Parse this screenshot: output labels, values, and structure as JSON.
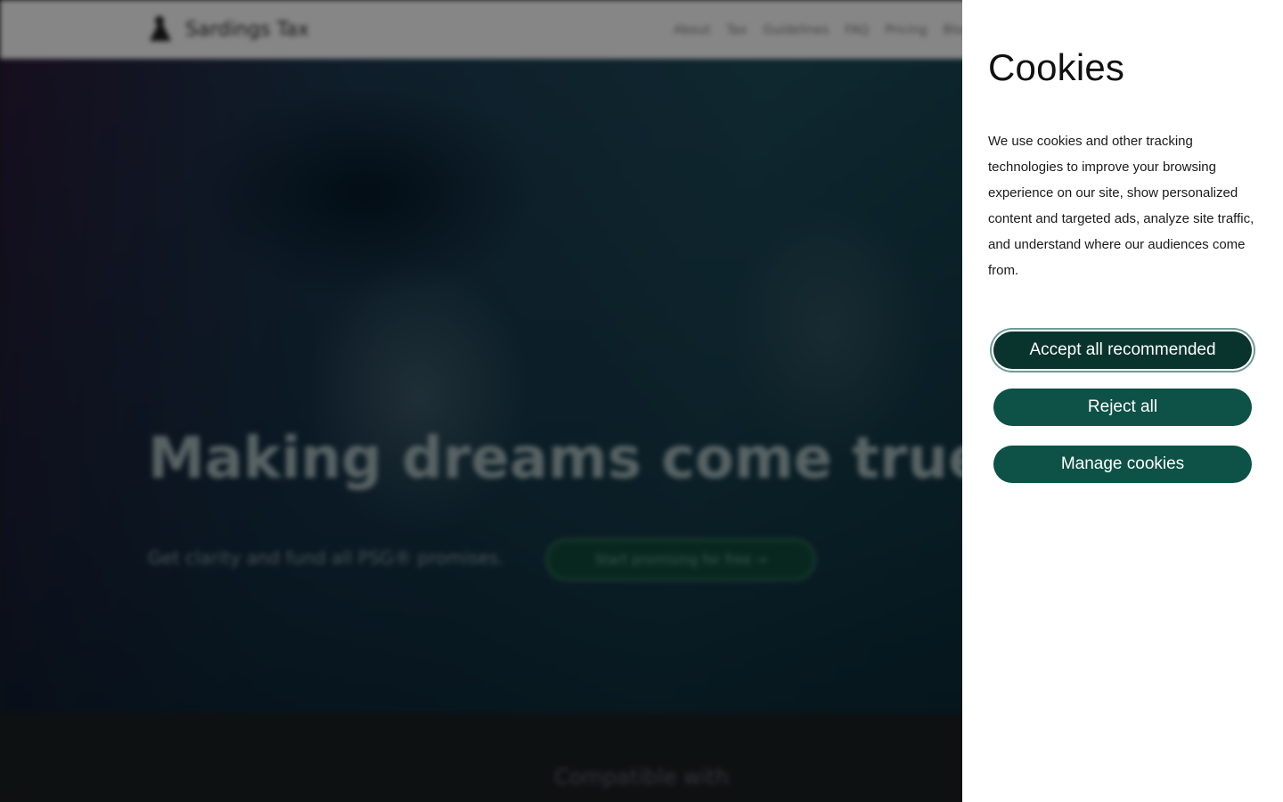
{
  "background_page": {
    "brand_name": "Sardings Tax",
    "nav_items": [
      "About",
      "Tax",
      "Guidelines",
      "FAQ",
      "Pricing",
      "Blog"
    ],
    "hero_title": "Making dreams come true",
    "hero_subtitle": "Get clarity and fund all PSG® promises.",
    "hero_cta_label": "Start promising for free →",
    "compatible_label": "Compatible with"
  },
  "cookie_panel": {
    "title": "Cookies",
    "description": "We use cookies and other tracking technologies to improve your browsing experience on our site, show personalized content and targeted ads, analyze site traffic, and understand where our audiences come from.",
    "accept_label": "Accept all recommended",
    "reject_label": "Reject all",
    "manage_label": "Manage cookies"
  },
  "colors": {
    "button_primary": "#0d5147",
    "button_focused": "#08342d",
    "panel_background": "#ffffff"
  }
}
